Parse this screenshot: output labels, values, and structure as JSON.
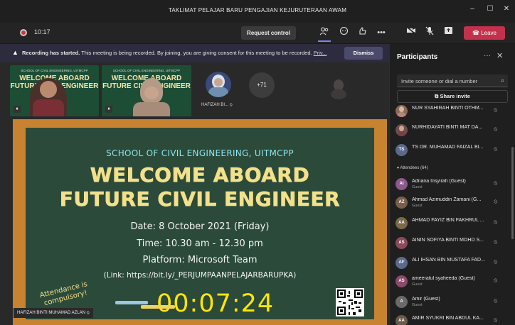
{
  "window": {
    "title": "TAKLIMAT PELAJAR BARU PENGAJIAN KEJURUTERAAN AWAM",
    "controls": [
      "–",
      "☐",
      "✕"
    ]
  },
  "toolbar": {
    "elapsed_time": "10:17",
    "request_control_label": "Request control",
    "leave_label": "Leave",
    "icons": [
      "people-icon",
      "chat-icon",
      "reactions-icon",
      "more-icon",
      "camera-off-icon",
      "mic-off-icon",
      "share-icon"
    ],
    "more_glyph": "•••"
  },
  "banner": {
    "title": "Recording has started.",
    "message": "This meeting is being recorded. By joining, you are giving consent for this meeting to be recorded.",
    "link": "Priv...",
    "dismiss_label": "Dismiss"
  },
  "stage": {
    "tiles": [
      {
        "board_small": "SCHOOL OF CIVIL ENGINEERING, UITMCPP",
        "board_text": "WELCOME ABOARD\nFUTURE CIVIL ENGINEER"
      },
      {
        "board_small": "SCHOOL OF CIVIL ENGINEERING, UITMCPP",
        "board_text": "WELCOME ABOARD\nFUTURE CIVIL ENGINEER"
      }
    ],
    "participant_tile_name": "HAFIZAH BI...",
    "overflow_count": "+71",
    "presenter_name": "HAFIZAH BINTI MUHAMAD AZLAN"
  },
  "slide": {
    "school": "SCHOOL OF CIVIL ENGINEERING, UITMCPP",
    "welcome": "WELCOME ABOARD",
    "future": "FUTURE CIVIL ENGINEER",
    "date": "Date: 8 October 2021 (Friday)",
    "time": "Time: 10.30 am - 12.30 pm",
    "platform": "Platform: Microsoft Team",
    "link": "(Link: https://bit.ly/_PERJUMPAANPELAJARBARUPKA)",
    "attendance": "Attendance is compulsory!",
    "countdown": "00:07:24"
  },
  "panel": {
    "title": "Participants",
    "more_glyph": "···",
    "invite_placeholder": "Invite someone or dial a number",
    "share_invite_label": "Share invite",
    "presenters": [
      {
        "initials": "",
        "name": "NUR SYAHIRAH BINTI OTHM...",
        "color": "#8a6a55"
      },
      {
        "initials": "",
        "name": "NURHIDAYATI BINTI MAT DA...",
        "color": "#6b4f4f"
      },
      {
        "initials": "TS",
        "name": "TS DR. MUHAMAD FAIZAL BI...",
        "color": "#5b6a8a"
      }
    ],
    "attendees_label": "Attendees (64)",
    "attendees": [
      {
        "initials": "AI",
        "name": "Adriana Insyirah (Guest)",
        "sub": "Guest",
        "color": "#8a5a8a"
      },
      {
        "initials": "AZ",
        "name": "Ahmad Azimuddin Zamani (G...",
        "sub": "Guest",
        "color": "#7a5f4a"
      },
      {
        "initials": "AA",
        "name": "AHMAD FAYIZ BIN FAKHRUL ...",
        "sub": "",
        "color": "#7a6a4a"
      },
      {
        "initials": "AS",
        "name": "AININ SOFIYA BINTI MOHD S...",
        "sub": "",
        "color": "#8a4a5a"
      },
      {
        "initials": "AF",
        "name": "ALI IHSAN BIN MUSTAFA FAD...",
        "sub": "",
        "color": "#5a6a8a"
      },
      {
        "initials": "AS",
        "name": "ameeratul syaheeda (Guest)",
        "sub": "Guest",
        "color": "#8a4a6a"
      },
      {
        "initials": "A",
        "name": "Amir (Guest)",
        "sub": "Guest",
        "color": "#6a6a6a"
      },
      {
        "initials": "AA",
        "name": "AMIR SYUKRI BIN ABDUL KA...",
        "sub": "",
        "color": "#6a5a4a"
      }
    ]
  }
}
